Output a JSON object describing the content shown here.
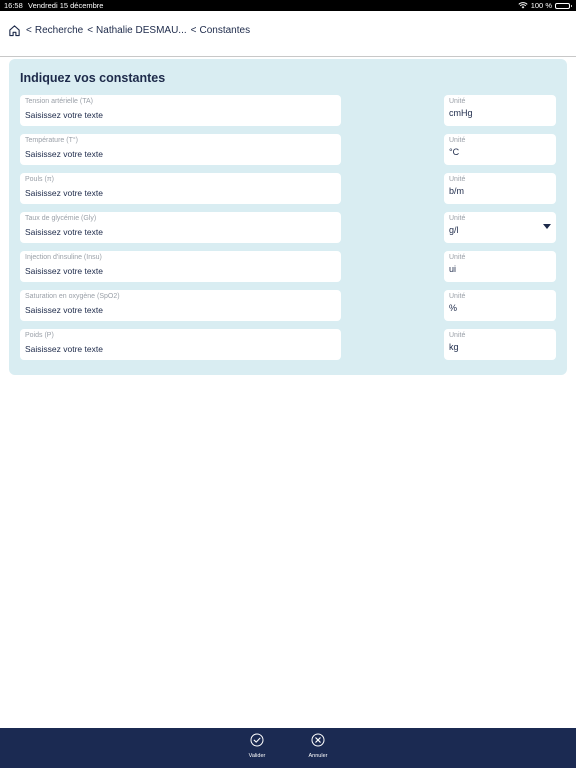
{
  "status_bar": {
    "time": "16:58",
    "date": "Vendredi 15 décembre",
    "battery": "100 %"
  },
  "breadcrumb": {
    "items": [
      "Recherche",
      "Nathalie DESMAU...",
      "Constantes"
    ],
    "separator": "<"
  },
  "form": {
    "title": "Indiquez vos constantes",
    "rows": [
      {
        "label": "Tension artérielle (TA)",
        "value": "Saisissez votre texte",
        "unit_label": "Unité",
        "unit": "cmHg"
      },
      {
        "label": "Température (T°)",
        "value": "Saisissez votre texte",
        "unit_label": "Unité",
        "unit": "°C"
      },
      {
        "label": "Pouls (π)",
        "value": "Saisissez votre texte",
        "unit_label": "Unité",
        "unit": "b/m"
      },
      {
        "label": "Taux de glycémie (Gly)",
        "value": "Saisissez votre texte",
        "unit_label": "Unité",
        "unit": "g/l"
      },
      {
        "label": "Injection d'insuline (Insu)",
        "value": "Saisissez votre texte",
        "unit_label": "Unité",
        "unit": "ui"
      },
      {
        "label": "Saturation en oxygène (SpO2)",
        "value": "Saisissez votre texte",
        "unit_label": "Unité",
        "unit": "%"
      },
      {
        "label": "Poids (P)",
        "value": "Saisissez votre texte",
        "unit_label": "Unité",
        "unit": "kg"
      }
    ]
  },
  "footer": {
    "validate_label": "Valider",
    "cancel_label": "Annuler"
  },
  "colors": {
    "navy": "#1b2a52",
    "card_bg": "#d9edf2",
    "text": "#1d2a4a"
  }
}
